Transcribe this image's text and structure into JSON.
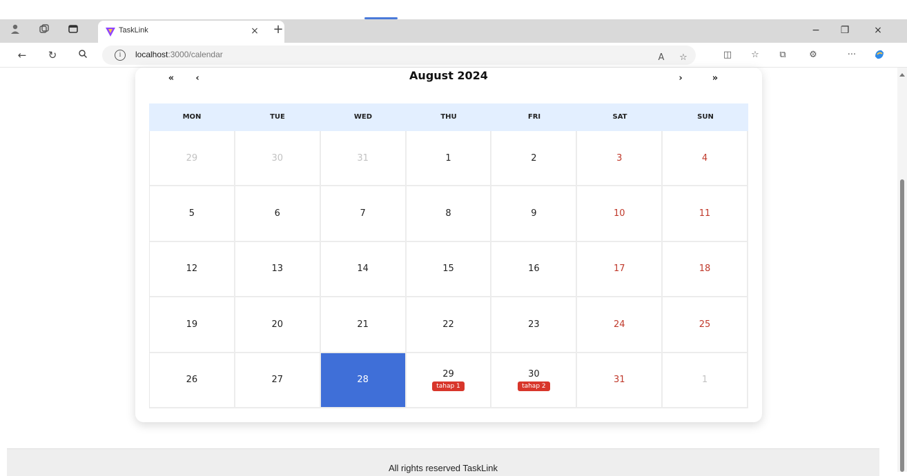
{
  "browser": {
    "tab_title": "TaskLink",
    "url_host": "localhost",
    "url_path": ":3000/calendar",
    "icons": {
      "profile": "profile-icon",
      "workspaces": "workspaces-icon",
      "tab_actions": "tab-actions-icon",
      "close_tab": "close-icon",
      "new_tab": "plus-icon",
      "minimize": "minimize-icon",
      "restore": "restore-icon",
      "close_window": "close-icon",
      "back": "back-arrow-icon",
      "refresh": "refresh-icon",
      "search": "search-icon",
      "site_info": "info-icon",
      "read_aloud": "read-aloud-icon",
      "favorite": "star-icon",
      "split_screen": "split-screen-icon",
      "favorites": "favorites-icon",
      "collections": "collections-icon",
      "extensions": "extensions-icon",
      "more": "more-icon",
      "copilot": "copilot-icon"
    },
    "glyphs": {
      "close": "×",
      "plus": "+",
      "minimize": "−",
      "restore": "❐",
      "back": "←",
      "refresh": "↻",
      "search": "⚲",
      "info": "i",
      "read_aloud": "A",
      "star": "☆",
      "split": "◫",
      "favorites": "☆",
      "collections": "⧉",
      "extensions": "⚙",
      "more": "···"
    }
  },
  "calendar": {
    "month_title": "August 2024",
    "nav": {
      "prev_year": "«",
      "prev_month": "‹",
      "next_month": "›",
      "next_year": "»"
    },
    "weekdays": [
      "MON",
      "TUE",
      "WED",
      "THU",
      "FRI",
      "SAT",
      "SUN"
    ],
    "weeks": [
      [
        {
          "day": "29",
          "state": "muted"
        },
        {
          "day": "30",
          "state": "muted"
        },
        {
          "day": "31",
          "state": "muted"
        },
        {
          "day": "1",
          "state": "normal"
        },
        {
          "day": "2",
          "state": "normal"
        },
        {
          "day": "3",
          "state": "weekend"
        },
        {
          "day": "4",
          "state": "weekend"
        }
      ],
      [
        {
          "day": "5",
          "state": "normal"
        },
        {
          "day": "6",
          "state": "normal"
        },
        {
          "day": "7",
          "state": "normal"
        },
        {
          "day": "8",
          "state": "normal"
        },
        {
          "day": "9",
          "state": "normal"
        },
        {
          "day": "10",
          "state": "weekend"
        },
        {
          "day": "11",
          "state": "weekend"
        }
      ],
      [
        {
          "day": "12",
          "state": "normal"
        },
        {
          "day": "13",
          "state": "normal"
        },
        {
          "day": "14",
          "state": "normal"
        },
        {
          "day": "15",
          "state": "normal"
        },
        {
          "day": "16",
          "state": "normal"
        },
        {
          "day": "17",
          "state": "weekend"
        },
        {
          "day": "18",
          "state": "weekend"
        }
      ],
      [
        {
          "day": "19",
          "state": "normal"
        },
        {
          "day": "20",
          "state": "normal"
        },
        {
          "day": "21",
          "state": "normal"
        },
        {
          "day": "22",
          "state": "normal"
        },
        {
          "day": "23",
          "state": "normal"
        },
        {
          "day": "24",
          "state": "weekend"
        },
        {
          "day": "25",
          "state": "weekend"
        }
      ],
      [
        {
          "day": "26",
          "state": "normal"
        },
        {
          "day": "27",
          "state": "normal"
        },
        {
          "day": "28",
          "state": "selected"
        },
        {
          "day": "29",
          "state": "normal",
          "event": "tahap 1"
        },
        {
          "day": "30",
          "state": "normal",
          "event": "tahap 2"
        },
        {
          "day": "31",
          "state": "weekend"
        },
        {
          "day": "1",
          "state": "muted"
        }
      ]
    ]
  },
  "footer": {
    "text": "All rights reserved TaskLink"
  },
  "colors": {
    "selected_day": "#3f6fd8",
    "weekend_text": "#c0392b",
    "event_badge": "#d8362b",
    "weekday_header_bg": "#e3efff"
  }
}
